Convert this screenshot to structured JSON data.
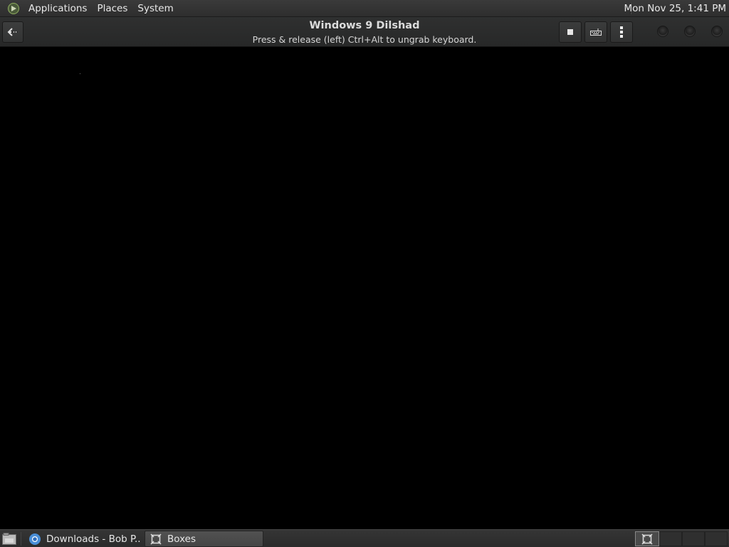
{
  "top_panel": {
    "menu": {
      "applications": "Applications",
      "places": "Places",
      "system": "System"
    },
    "clock": "Mon Nov 25,  1:41 PM",
    "menu_icon": "distro-logo-icon"
  },
  "header_bar": {
    "title": "Windows 9  Dilshad",
    "subtitle": "Press & release (left) Ctrl+Alt to ungrab keyboard.",
    "buttons": [
      "back-arrow-icon",
      "stop-icon",
      "keyboard-icon",
      "menu-kebab-icon"
    ],
    "window_controls": [
      "minimize",
      "maximize",
      "close"
    ]
  },
  "taskbar": {
    "show_desktop_icon": "show-desktop-icon",
    "tasks": [
      {
        "label": "Downloads - Bob P...",
        "icon": "chromium-icon",
        "active": false
      },
      {
        "label": "Boxes",
        "icon": "boxes-icon",
        "active": true
      }
    ],
    "workspaces": 4,
    "active_workspace": 1
  },
  "colors": {
    "panel_bg": "#2e2e2e",
    "header_bg": "#2b2c2c",
    "vm_bg": "#000000",
    "text": "#e6e6e6"
  }
}
